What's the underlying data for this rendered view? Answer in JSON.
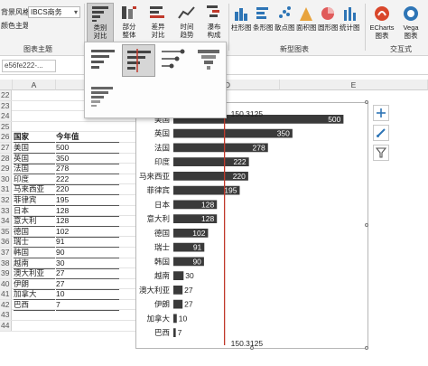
{
  "ribbon": {
    "theme": {
      "bg_style_label": "背景风格",
      "bg_style_value": "IBCS商务",
      "color_theme_label": "颜色主题",
      "group_label": "图表主题"
    },
    "buttons": [
      {
        "line1": "类别",
        "line2": "对比"
      },
      {
        "line1": "部分",
        "line2": "整体"
      },
      {
        "line1": "差异",
        "line2": "对比"
      },
      {
        "line1": "时间",
        "line2": "趋势"
      },
      {
        "line1": "瀑布",
        "line2": "构成"
      }
    ],
    "new_charts": [
      "柱形图",
      "条形图",
      "散点图",
      "面积图",
      "圆形图",
      "统计图"
    ],
    "new_charts_group": "新型图表",
    "interactive": [
      {
        "line1": "ECharts",
        "line2": "图表"
      },
      {
        "line1": "Vega",
        "line2": "图表"
      }
    ],
    "interactive_group": "交互式"
  },
  "name_box": "e56fe222-...",
  "columns": {
    "a": "A",
    "b": "B",
    "d": "D",
    "e": "E"
  },
  "sheet": {
    "first_row_number": 22,
    "header": {
      "name": "国家",
      "value": "今年值"
    },
    "rows": [
      {
        "name": "美国",
        "value": "500"
      },
      {
        "name": "英国",
        "value": "350"
      },
      {
        "name": "法国",
        "value": "278"
      },
      {
        "name": "印度",
        "value": "222"
      },
      {
        "name": "马来西亚",
        "value": "220"
      },
      {
        "name": "菲律宾",
        "value": "195"
      },
      {
        "name": "日本",
        "value": "128"
      },
      {
        "name": "意大利",
        "value": "128"
      },
      {
        "name": "德国",
        "value": "102"
      },
      {
        "name": "瑞士",
        "value": "91"
      },
      {
        "name": "韩国",
        "value": "90"
      },
      {
        "name": "越南",
        "value": "30"
      },
      {
        "name": "澳大利亚",
        "value": "27"
      },
      {
        "name": "伊朗",
        "value": "27"
      },
      {
        "name": "加拿大",
        "value": "10"
      },
      {
        "name": "巴西",
        "value": "7"
      }
    ]
  },
  "chart_data": {
    "type": "bar",
    "orientation": "horizontal",
    "categories": [
      "美国",
      "英国",
      "法国",
      "印度",
      "马来西亚",
      "菲律宾",
      "日本",
      "意大利",
      "德国",
      "瑞士",
      "韩国",
      "越南",
      "澳大利亚",
      "伊朗",
      "加拿大",
      "巴西"
    ],
    "values": [
      500,
      350,
      278,
      222,
      220,
      195,
      128,
      128,
      102,
      91,
      90,
      30,
      27,
      27,
      10,
      7
    ],
    "reference_line": {
      "value": 150.3125,
      "label": "150.3125"
    },
    "bar_color": "#3a3a3a",
    "reference_color": "#c0392b",
    "xlim": [
      0,
      560
    ],
    "grid": false,
    "legend": "none"
  },
  "colors": {
    "accent": "#c0392b",
    "bar": "#3a3a3a"
  }
}
